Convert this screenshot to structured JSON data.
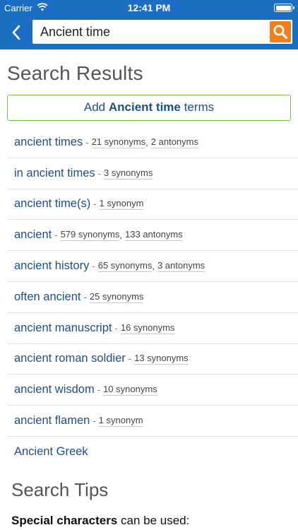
{
  "status_bar": {
    "carrier": "Carrier",
    "time": "12:41 PM"
  },
  "search": {
    "value": "Ancient time"
  },
  "page_title": "Search Results",
  "add_terms": {
    "prefix": "Add ",
    "term": "Ancient time",
    "suffix": " terms"
  },
  "results": [
    {
      "term": "ancient times",
      "synonyms": "21 synonyms",
      "antonyms": "2 antonyms"
    },
    {
      "term": "in ancient times",
      "synonyms": "3 synonyms"
    },
    {
      "term": "ancient time(s)",
      "synonyms": "1 synonym"
    },
    {
      "term": "ancient",
      "synonyms": "579 synonyms",
      "antonyms": "133 antonyms"
    },
    {
      "term": "ancient history",
      "synonyms": "65 synonyms",
      "antonyms": "3 antonyms"
    },
    {
      "term": "often ancient",
      "synonyms": "25 synonyms"
    },
    {
      "term": "ancient manuscript",
      "synonyms": "16 synonyms"
    },
    {
      "term": "ancient roman soldier",
      "synonyms": "13 synonyms"
    },
    {
      "term": "ancient wisdom",
      "synonyms": "10 synonyms"
    },
    {
      "term": "ancient flamen",
      "synonyms": "1 synonym"
    },
    {
      "term": "Ancient Greek"
    }
  ],
  "separator": "-",
  "comma": ",",
  "tips": {
    "title": "Search Tips",
    "bold": "Special characters",
    "rest": " can be used:"
  },
  "colors": {
    "header": "#1b6ec2",
    "search_button": "#f07f1e",
    "link": "#1e4f8a",
    "add_border": "#7cc24d"
  },
  "icons": [
    "wifi-icon",
    "battery-icon",
    "back-chevron-icon",
    "search-icon"
  ]
}
